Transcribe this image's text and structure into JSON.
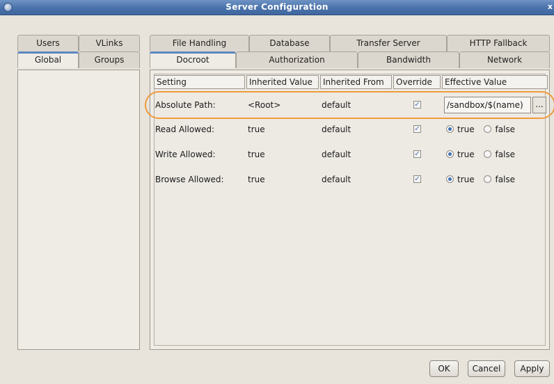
{
  "window": {
    "title": "Server Configuration"
  },
  "left_tabs": {
    "top_row": [
      "Users",
      "VLinks"
    ],
    "bottom_row": [
      "Global",
      "Groups"
    ]
  },
  "right_tabs": {
    "top_row": [
      "File Handling",
      "Database",
      "Transfer Server",
      "HTTP Fallback"
    ],
    "bottom_row": [
      "Docroot",
      "Authorization",
      "Bandwidth",
      "Network"
    ]
  },
  "table": {
    "headers": [
      "Setting",
      "Inherited Value",
      "Inherited From",
      "Override",
      "Effective Value"
    ],
    "rows": [
      {
        "setting": "Absolute Path:",
        "inherited_value": "<Root>",
        "inherited_from": "default",
        "override": true,
        "effective_value": "/sandbox/$(name)"
      },
      {
        "setting": "Read Allowed:",
        "inherited_value": "true",
        "inherited_from": "default",
        "override": true,
        "radio_true": "true",
        "radio_false": "false",
        "selected": "true"
      },
      {
        "setting": "Write Allowed:",
        "inherited_value": "true",
        "inherited_from": "default",
        "override": true,
        "radio_true": "true",
        "radio_false": "false",
        "selected": "true"
      },
      {
        "setting": "Browse Allowed:",
        "inherited_value": "true",
        "inherited_from": "default",
        "override": true,
        "radio_true": "true",
        "radio_false": "false",
        "selected": "true"
      }
    ],
    "browse_button": "..."
  },
  "footer": {
    "ok": "OK",
    "cancel": "Cancel",
    "apply": "Apply"
  },
  "colors": {
    "titlebar": "#4a72aa",
    "highlight": "#f09a3e",
    "active_tab_accent": "#5b86c0"
  }
}
